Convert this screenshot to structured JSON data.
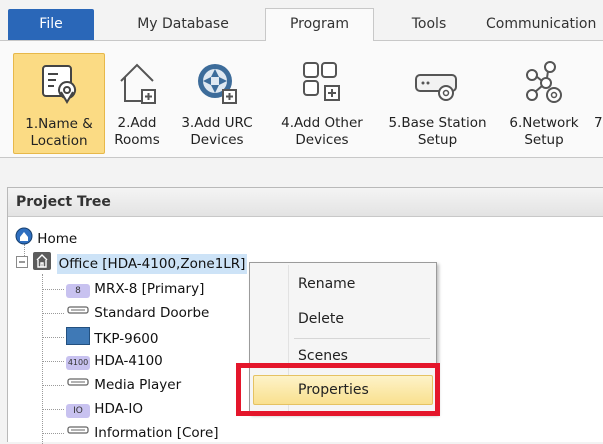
{
  "tabs": [
    {
      "label": "File"
    },
    {
      "label": "My Database"
    },
    {
      "label": "Program"
    },
    {
      "label": "Tools"
    },
    {
      "label": "Communication"
    }
  ],
  "ribbon": {
    "buttons": [
      {
        "line1": "1.Name &",
        "line2": "Location",
        "icon": "location-pin-icon"
      },
      {
        "line1": "2.Add",
        "line2": "Rooms",
        "icon": "add-room-icon"
      },
      {
        "line1": "3.Add URC",
        "line2": "Devices",
        "icon": "urc-device-icon"
      },
      {
        "line1": "4.Add Other",
        "line2": "Devices",
        "icon": "other-devices-icon"
      },
      {
        "line1": "5.Base Station",
        "line2": "Setup",
        "icon": "base-station-icon"
      },
      {
        "line1": "6.Network",
        "line2": "Setup",
        "icon": "network-icon"
      },
      {
        "line1": "7",
        "line2": ""
      }
    ]
  },
  "tree": {
    "title": "Project Tree",
    "root": "Home",
    "office": "Office [HDA-4100,Zone1LR]",
    "children": [
      {
        "label": "MRX-8 [Primary]",
        "badge": "8"
      },
      {
        "label": "Standard Doorbe"
      },
      {
        "label": "TKP-9600"
      },
      {
        "label": "HDA-4100",
        "badge": "4100"
      },
      {
        "label": "Media Player"
      },
      {
        "label": "HDA-IO",
        "badge": "IO"
      },
      {
        "label": "Information [Core]"
      }
    ]
  },
  "context_menu": {
    "items": [
      "Rename",
      "Delete",
      "Scenes",
      "Properties"
    ]
  }
}
